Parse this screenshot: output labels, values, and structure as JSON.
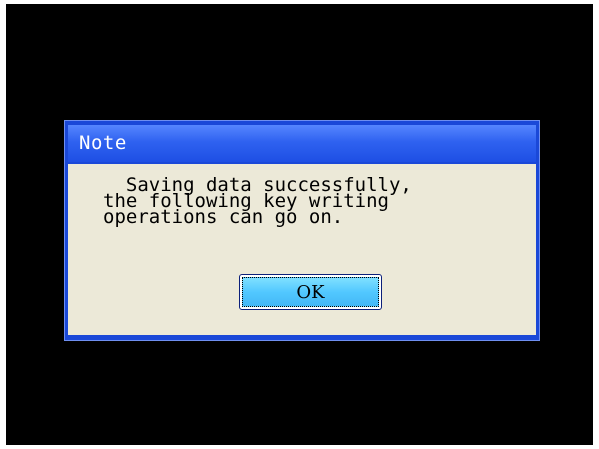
{
  "dialog": {
    "title": "Note",
    "message_lines": [
      "  Saving data successfully,",
      "the following key writing",
      "operations can go on."
    ],
    "ok_label": "OK"
  },
  "colors": {
    "background": "#000000",
    "title_bar": "#2f62f0",
    "dialog_body": "#ece9d8",
    "ok_button": "#52c8ff"
  }
}
